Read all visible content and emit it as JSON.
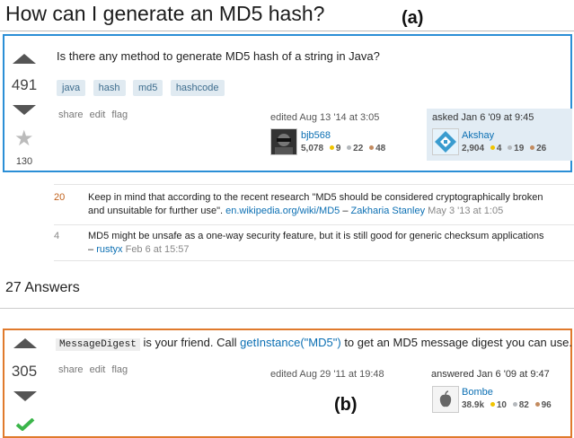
{
  "question": {
    "title": "How can I generate an MD5 hash?",
    "panel_label": "(a)",
    "votes": "491",
    "favorites": "130",
    "body": "Is there any method to generate MD5 hash of a string in Java?",
    "tags": [
      "java",
      "hash",
      "md5",
      "hashcode"
    ],
    "actions": [
      "share",
      "edit",
      "flag"
    ],
    "edited": {
      "text": "edited Aug 13 '14 at 3:05",
      "user": "bjb568",
      "rep": "5,078",
      "gold": "",
      "silver": "9",
      "bronze": "22",
      "bronze2": "48"
    },
    "asked": {
      "text": "asked Jan 6 '09 at 9:45",
      "user": "Akshay",
      "rep": "2,904",
      "gold": "4",
      "silver": "19",
      "bronze": "26"
    }
  },
  "comments": [
    {
      "score": "20",
      "line1": "Keep in mind that according to the recent research \"MD5 should be considered cryptographically broken",
      "line2_prefix": "and unsuitable for further use\".",
      "link": "en.wikipedia.org/wiki/MD5",
      "dash": "–",
      "user": "Zakharia Stanley",
      "time": "May 3 '13 at 1:05"
    },
    {
      "score": "4",
      "line1": "MD5 might be unsafe as a one-way security feature, but it is still good for generic checksum applications",
      "dash": "–",
      "user": "rustyx",
      "time": "Feb 6 at 15:57"
    }
  ],
  "answers_header": "27 Answers",
  "answer": {
    "votes": "305",
    "code": "MessageDigest",
    "text1": "is your friend. Call",
    "link": "getInstance(\"MD5\")",
    "text2": "to get an MD5 message digest you can use.",
    "actions": [
      "share",
      "edit",
      "flag"
    ],
    "edited": "edited Aug 29 '11 at 19:48",
    "answered": "answered Jan 6 '09 at 9:47",
    "user": "Bombe",
    "rep": "38.9k",
    "gold": "10",
    "silver": "82",
    "bronze": "96",
    "panel_label": "(b)"
  },
  "colors": {
    "box_a": "#2b8fd6",
    "box_b": "#e07a2c",
    "link": "#0b6fb3",
    "accepted": "#3bb54a"
  }
}
